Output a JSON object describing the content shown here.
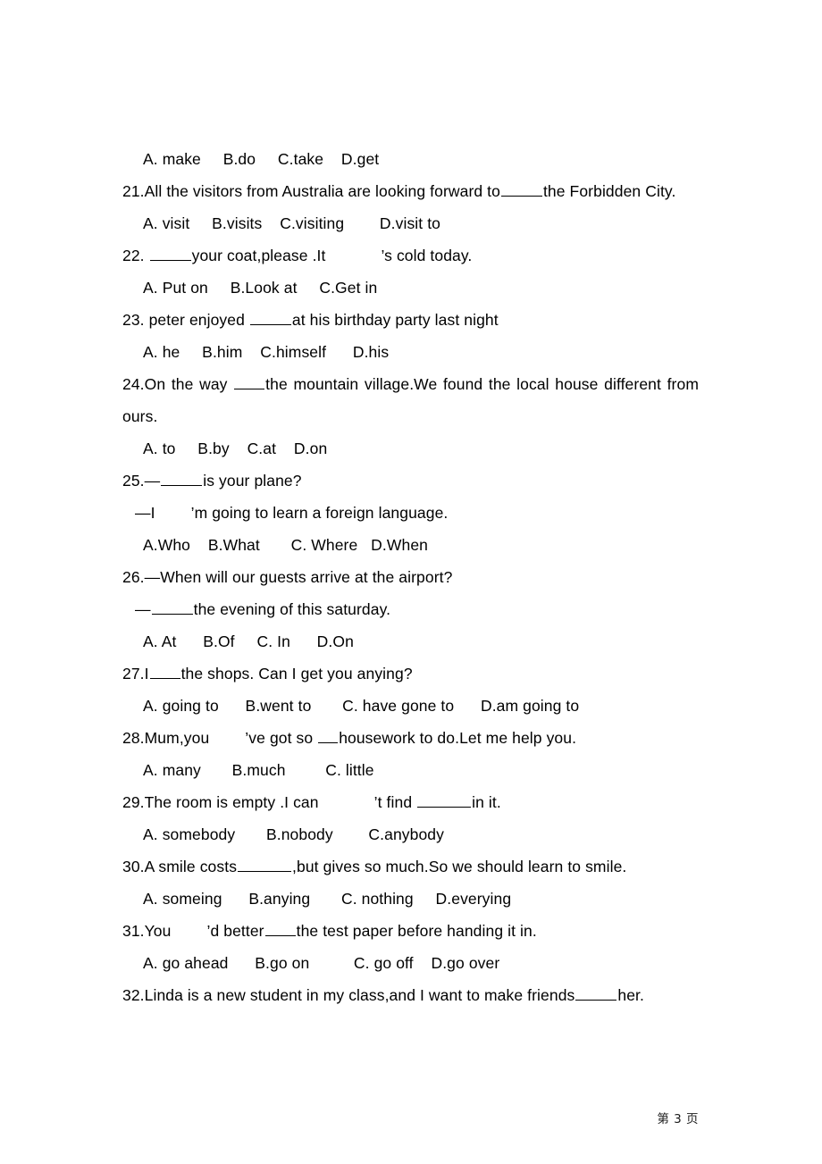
{
  "document": {
    "page_label": "第 3 页",
    "page_number": "3"
  },
  "lines": [
    {
      "id": "q20-options",
      "kind": "options",
      "text": "A. make     B.do     C.take    D.get"
    },
    {
      "id": "q21-stem-a",
      "kind": "stem",
      "text": "21.All the visitors from Australia are looking forward to"
    },
    {
      "id": "q21-stem-b",
      "kind": "stem",
      "text": "the Forbidden City."
    },
    {
      "id": "q21-options",
      "kind": "options",
      "text": "A. visit     B.visits    C.visiting        D.visit to"
    },
    {
      "id": "q22-stem-a",
      "kind": "stem",
      "text": "22. "
    },
    {
      "id": "q22-stem-b",
      "kind": "stem",
      "text": "your coat,please .It"
    },
    {
      "id": "q22-stem-c",
      "kind": "stem",
      "text": "s cold today."
    },
    {
      "id": "q22-options",
      "kind": "options",
      "text": "A. Put on     B.Look at     C.Get in"
    },
    {
      "id": "q23-stem-a",
      "kind": "stem",
      "text": "23. peter enjoyed "
    },
    {
      "id": "q23-stem-b",
      "kind": "stem",
      "text": "at his birthday party last night"
    },
    {
      "id": "q23-options",
      "kind": "options",
      "text": "A. he     B.him    C.himself      D.his"
    },
    {
      "id": "q24-stem-a",
      "kind": "stem",
      "text": "24.On the way "
    },
    {
      "id": "q24-stem-b",
      "kind": "stem",
      "text": "the mountain village.We found the local house different from"
    },
    {
      "id": "q24-stem-cont",
      "kind": "cont",
      "text": "ours."
    },
    {
      "id": "q24-options",
      "kind": "options",
      "text": "A. to     B.by    C.at    D.on"
    },
    {
      "id": "q25-stem-a",
      "kind": "stem",
      "text": "25.—"
    },
    {
      "id": "q25-stem-b",
      "kind": "stem",
      "text": "is your plane?"
    },
    {
      "id": "q25-reply-a",
      "kind": "reply",
      "text": "—I"
    },
    {
      "id": "q25-reply-b",
      "kind": "reply",
      "text": "m going to learn a foreign language."
    },
    {
      "id": "q25-options",
      "kind": "options",
      "text": "A.Who    B.What       C. Where   D.When"
    },
    {
      "id": "q26-stem",
      "kind": "stem",
      "text": "26.—When will our guests arrive at the airport?"
    },
    {
      "id": "q26-reply-a",
      "kind": "reply",
      "text": "—"
    },
    {
      "id": "q26-reply-b",
      "kind": "reply",
      "text": "the evening of this saturday."
    },
    {
      "id": "q26-options",
      "kind": "options",
      "text": "A. At      B.Of     C. In      D.On"
    },
    {
      "id": "q27-stem-a",
      "kind": "stem",
      "text": "27.I"
    },
    {
      "id": "q27-stem-b",
      "kind": "stem",
      "text": "the shops. Can I get you anying?"
    },
    {
      "id": "q27-options",
      "kind": "options",
      "text": "A. going to      B.went to       C. have gone to      D.am going to"
    },
    {
      "id": "q28-stem-a",
      "kind": "stem",
      "text": "28.Mum,you"
    },
    {
      "id": "q28-stem-b",
      "kind": "stem",
      "text": "ve got so "
    },
    {
      "id": "q28-stem-c",
      "kind": "stem",
      "text": "housework to do.Let me help you."
    },
    {
      "id": "q28-options",
      "kind": "options",
      "text": "A. many       B.much         C. little"
    },
    {
      "id": "q29-stem-a",
      "kind": "stem",
      "text": "29.The room is empty .I can"
    },
    {
      "id": "q29-stem-b",
      "kind": "stem",
      "text": "t find "
    },
    {
      "id": "q29-stem-c",
      "kind": "stem",
      "text": "in it."
    },
    {
      "id": "q29-options",
      "kind": "options",
      "text": "A. somebody       B.nobody        C.anybody"
    },
    {
      "id": "q30-stem-a",
      "kind": "stem",
      "text": "30.A smile costs"
    },
    {
      "id": "q30-stem-b",
      "kind": "stem",
      "text": ",but gives so much.So we should learn to smile."
    },
    {
      "id": "q30-options",
      "kind": "options",
      "text": "A. someing      B.anying       C. nothing     D.everying"
    },
    {
      "id": "q31-stem-a",
      "kind": "stem",
      "text": "31.You"
    },
    {
      "id": "q31-stem-b",
      "kind": "stem",
      "text": "d better"
    },
    {
      "id": "q31-stem-c",
      "kind": "stem",
      "text": "the test paper before handing it in."
    },
    {
      "id": "q31-options",
      "kind": "options",
      "text": "A. go ahead      B.go on          C. go off    D.go over"
    },
    {
      "id": "q32-stem-a",
      "kind": "stem",
      "text": "32.Linda is a new student in my class,and I want to make friends"
    },
    {
      "id": "q32-stem-b",
      "kind": "stem",
      "text": "her."
    }
  ],
  "punctuation": {
    "apostrophe": "’",
    "em_dash": "—"
  }
}
